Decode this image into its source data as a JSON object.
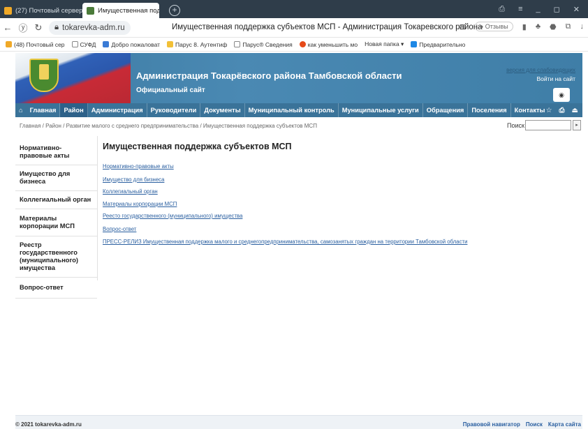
{
  "browser": {
    "tabs": [
      {
        "label": "(27) Почтовый сервер адм",
        "color": "#f0a928"
      },
      {
        "label": "Имущественная поддер",
        "color": "#4b7b3a"
      }
    ],
    "window_controls": [
      "⎙",
      "≡",
      "_",
      "◻",
      "✕"
    ],
    "url": "tokarevka-adm.ru",
    "page_title": "Имущественная поддержка субъектов МСП - Администрация Токаревского района",
    "reviews_label": "Отзывы",
    "bookmarks": [
      {
        "label": "(48) Почтовый сер",
        "color": "#f0a928"
      },
      {
        "label": "СУФД",
        "color": "#999999"
      },
      {
        "label": "Добро пожаловат",
        "color": "#3a7bd5"
      },
      {
        "label": "Парус 8. Аутентиф",
        "color": "#f2c037"
      },
      {
        "label": "Парус® Сведения",
        "color": "#999999"
      },
      {
        "label": "как уменьшить мо",
        "color": "#e64a19"
      },
      {
        "label": "Новая папка ▾",
        "color": "#ffffff"
      },
      {
        "label": "Предварительно",
        "color": "#1e88e5"
      }
    ]
  },
  "site": {
    "title": "Администрация Токарёвского района Тамбовской области",
    "subtitle": "Официальный сайт",
    "vision_link": "версия для слабовидящих",
    "login": "Войти на сайт",
    "eye_icon": "◉"
  },
  "nav": {
    "home_icon": "⌂",
    "items": [
      "Главная",
      "Район",
      "Администрация",
      "Руководители",
      "Документы",
      "Муниципальный контроль",
      "Муниципальные услуги",
      "Обращения",
      "Поселения",
      "Контакты"
    ],
    "active": "Район",
    "tools": [
      "☆",
      "⎙",
      "⏏"
    ]
  },
  "breadcrumb": "Главная / Район / Развитие малого с среднего предпринимательства / Имущественная поддержка субъектов МСП",
  "search": {
    "label": "Поиск",
    "button": "▸"
  },
  "sidebar": [
    "Нормативно-правовые акты",
    "Имущество для бизнеса",
    "Коллегиальный орган",
    "Материалы корпорации МСП",
    "Реестр государственного (муниципального) имущества",
    "Вопрос-ответ"
  ],
  "content": {
    "title": "Имущественная поддержка субъектов МСП",
    "links": [
      "Нормативно-правовые акты",
      "Имущество для бизнеса",
      "Коллегиальный орган",
      "Материалы корпорации МСП",
      "Реесто государственного (муниципального) имущества",
      "Вопрос-ответ",
      "ПРЕСС-РЕЛИЗ Имущественная поддержка малого и среднегопредпринимательства, самозанятых граждан на территории Тамбовской области"
    ]
  },
  "footer": {
    "copyright": "© 2021 tokarevka-adm.ru",
    "links": [
      "Правовой навигатор",
      "Поиск",
      "Карта сайта"
    ]
  }
}
